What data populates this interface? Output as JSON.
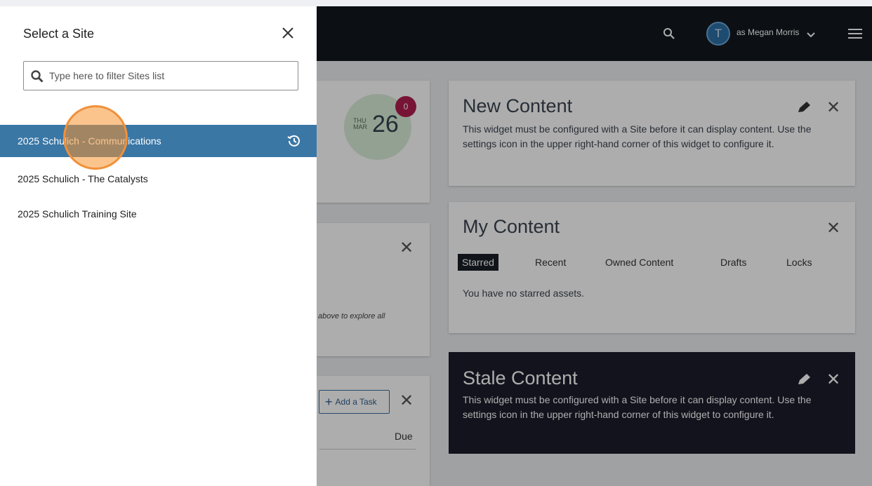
{
  "colors": {
    "topbar": "#13181f",
    "selected": "#3a77a5",
    "badge": "#b01e4e",
    "click_indicator": "#f0903a"
  },
  "header": {
    "user_initial": "T",
    "user_label": "as Megan Morris"
  },
  "calendar": {
    "dow": "THU",
    "month": "MAR",
    "day": "26",
    "badge_count": "0"
  },
  "panel": {
    "title": "Select a Site",
    "filter_placeholder": "Type here to filter Sites list",
    "sites": [
      {
        "label": "2025 Schulich - Communications",
        "selected": true
      },
      {
        "label": "2025 Schulich - The Catalysts",
        "selected": false
      },
      {
        "label": "2025 Schulich Training Site",
        "selected": false
      }
    ]
  },
  "partial_texts": {
    "explore": "above to explore all",
    "add_task": "Add a Task",
    "due": "Due"
  },
  "new_content": {
    "title": "New Content",
    "text": "This widget must be configured with a Site before it can display content. Use the settings icon in the upper right-hand corner of this widget to configure it."
  },
  "my_content": {
    "title": "My Content",
    "tabs": [
      "Starred",
      "Recent",
      "Owned Content",
      "Drafts",
      "Locks"
    ],
    "empty": "You have no starred assets."
  },
  "stale_content": {
    "title": "Stale Content",
    "text": "This widget must be configured with a Site before it can display content. Use the settings icon in the upper right-hand corner of this widget to configure it."
  },
  "icons": [
    "search-icon",
    "chevron-down-icon",
    "hamburger-icon",
    "close-icon",
    "pencil-icon",
    "history-icon",
    "plus-icon"
  ]
}
